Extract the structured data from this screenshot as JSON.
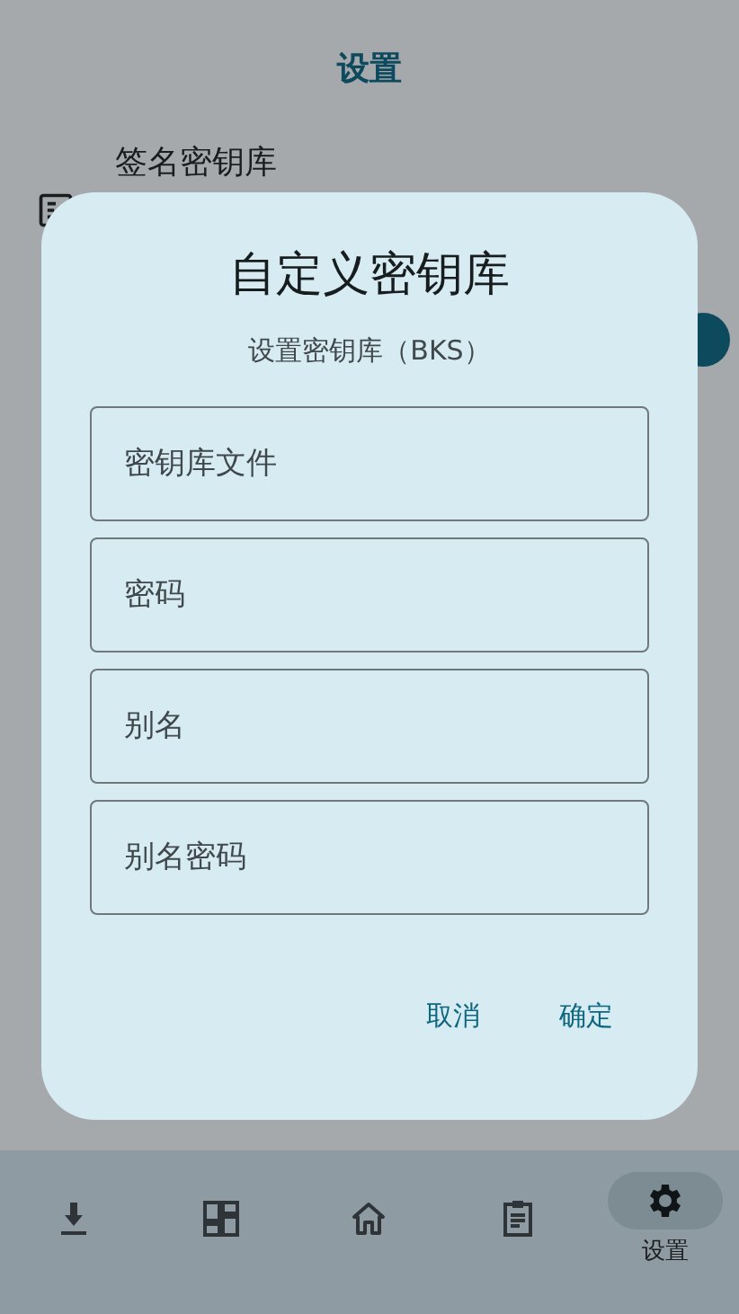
{
  "top_bar": {
    "title": "设置"
  },
  "settings_items": [
    {
      "label": "签名密钥库"
    }
  ],
  "dialog": {
    "title": "自定义密钥库",
    "subtitle": "设置密钥库（BKS）",
    "fields": [
      {
        "placeholder": "密钥库文件"
      },
      {
        "placeholder": "密码"
      },
      {
        "placeholder": "别名"
      },
      {
        "placeholder": "别名密码"
      }
    ],
    "buttons": [
      "取消",
      "确定"
    ]
  },
  "bottom_nav": [
    {
      "kind": "download",
      "selected": false
    },
    {
      "kind": "dashboard",
      "selected": false
    },
    {
      "kind": "home",
      "selected": false
    },
    {
      "kind": "clipboard",
      "selected": false
    },
    {
      "kind": "settings",
      "selected": true,
      "label": "设置"
    }
  ]
}
